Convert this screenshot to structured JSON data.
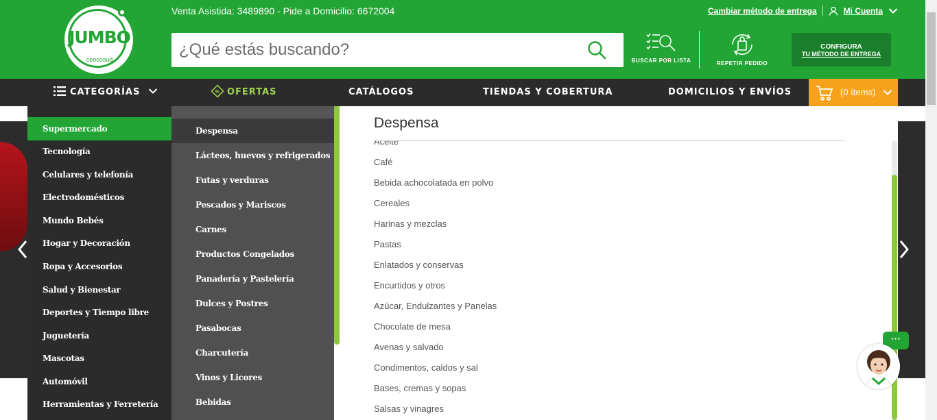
{
  "colors": {
    "brand_green": "#22a534",
    "nav_dark": "#2b2b2b",
    "cart_orange": "#f7a21b",
    "accent_lime": "#8dc63f"
  },
  "header": {
    "logo_text": "JUMBO",
    "logo_sub": "cencosud",
    "contact_info": "Venta Asistida: 3489890 - Pide a Domicilio: 6672004",
    "change_delivery_link": "Cambiar método de entrega",
    "account_label": "Mi Cuenta",
    "search_placeholder": "¿Qué estás buscando?",
    "list_search_label": "BUSCAR POR LISTA",
    "repeat_order_label": "REPETIR PEDIDO",
    "config_line1": "CONFIGURA",
    "config_line2": "TU MÉTODO DE ENTREGA"
  },
  "nav": {
    "categories": "CATEGORÍAS",
    "offers": "OFERTAS",
    "catalogs": "CATÁLOGOS",
    "stores": "TIENDAS Y COBERTURA",
    "delivery": "DOMICILIOS Y ENVÍOS",
    "cart": "(0 ítems)"
  },
  "menu": {
    "categories": [
      "Supermercado",
      "Tecnología",
      "Celulares y telefonía",
      "Electrodomésticos",
      "Mundo Bebés",
      "Hogar y Decoración",
      "Ropa y Accesorios",
      "Salud y Bienestar",
      "Deportes y Tiempo libre",
      "Juguetería",
      "Mascotas",
      "Automóvil",
      "Herramientas y Ferretería"
    ],
    "subcategories": [
      "Despensa",
      "Lácteos, huevos y refrigerados",
      "Futas y verduras",
      "Pescados y Mariscos",
      "Carnes",
      "Productos Congelados",
      "Panadería y Pastelería",
      "Dulces y Postres",
      "Pasabocas",
      "Charcutería",
      "Vinos y Licores",
      "Bebidas"
    ],
    "panel_title": "Despensa",
    "items": [
      "Aceite",
      "Café",
      "Bebida achocolatada en polvo",
      "Cereales",
      "Harinas y mezclas",
      "Pastas",
      "Enlatados y conservas",
      "Encurtidos y otros",
      "Azúcar, Endulzantes y Panelas",
      "Chocolate de mesa",
      "Avenas y salvado",
      "Condimentos, caldos y sal",
      "Bases, cremas y sopas",
      "Salsas y vinagres"
    ]
  },
  "chat": {
    "bubble": "···"
  }
}
